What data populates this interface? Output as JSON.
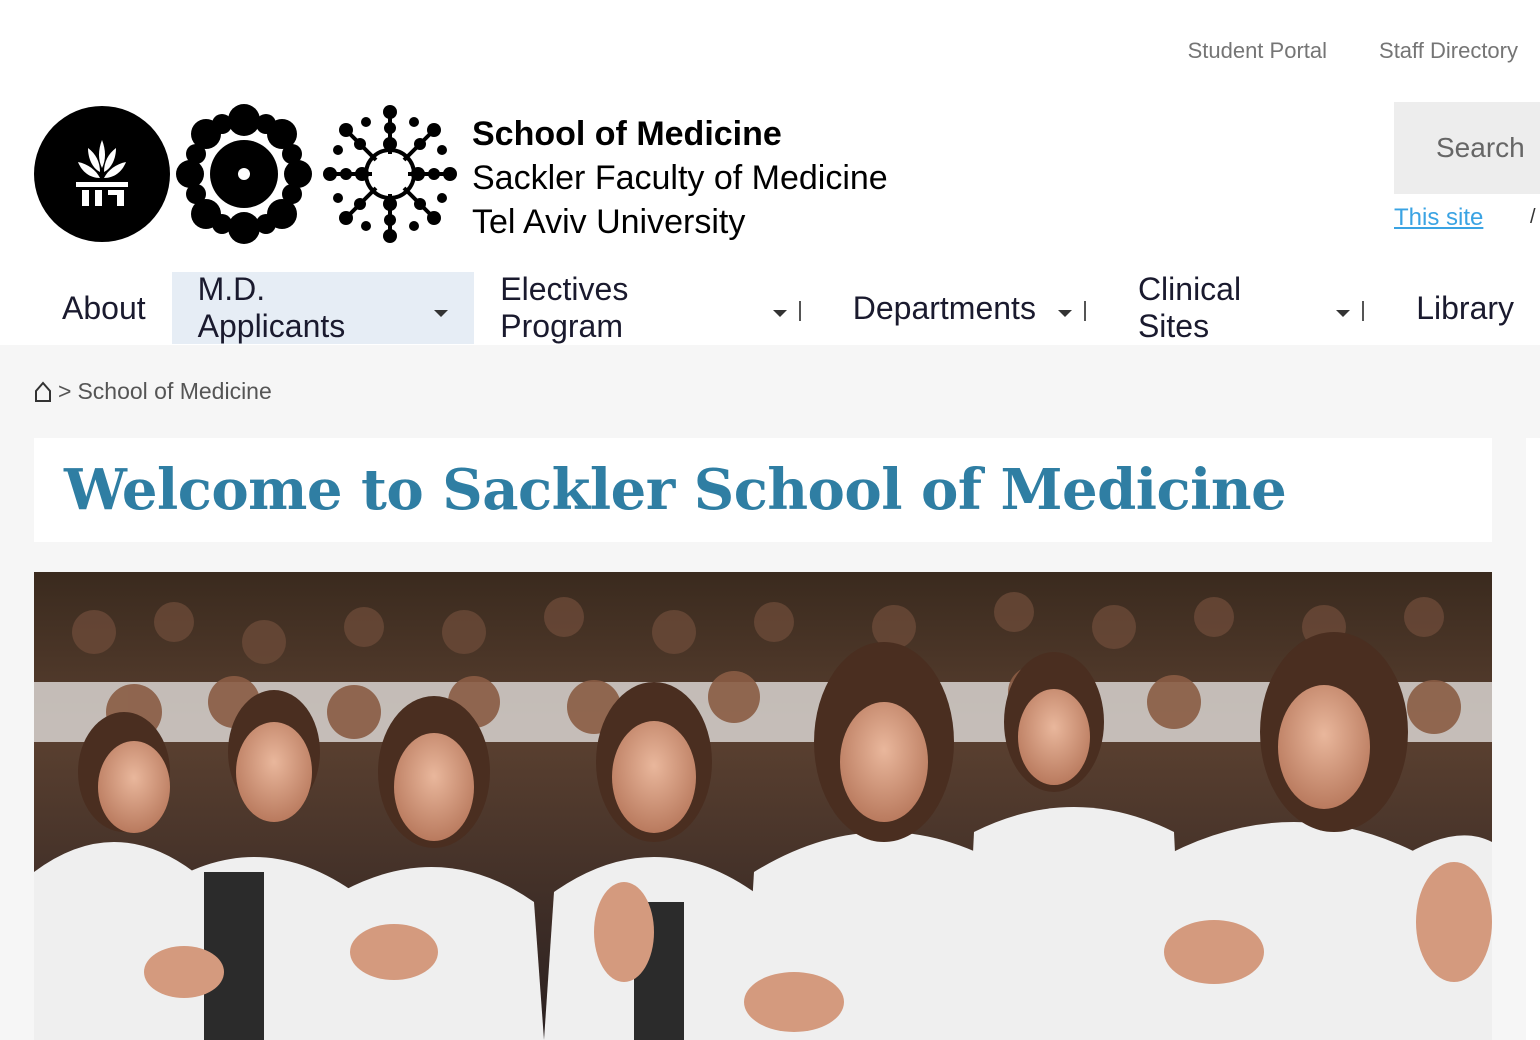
{
  "utility_nav": {
    "student_portal": "Student Portal",
    "staff_directory": "Staff Directory"
  },
  "branding": {
    "line1": "School of Medicine",
    "line2": "Sackler Faculty of Medicine",
    "line3": "Tel Aviv University",
    "logos": [
      "tel-aviv-university-seal",
      "flower-emblem",
      "molecule-emblem"
    ]
  },
  "search": {
    "placeholder": "Search",
    "scope_this_site": "This site",
    "scope_separator": "/"
  },
  "main_nav": {
    "items": [
      {
        "label": "About",
        "has_dropdown": false,
        "active": false
      },
      {
        "label": "M.D. Applicants",
        "has_dropdown": true,
        "active": true
      },
      {
        "label": "Electives Program",
        "has_dropdown": true,
        "active": false
      },
      {
        "label": "Departments",
        "has_dropdown": true,
        "active": false
      },
      {
        "label": "Clinical Sites",
        "has_dropdown": true,
        "active": false
      },
      {
        "label": "Library",
        "has_dropdown": false,
        "active": false
      }
    ]
  },
  "breadcrumb": {
    "home_icon": "home-icon",
    "separator": ">",
    "current": "School of Medicine"
  },
  "page": {
    "title": "Welcome to Sackler School of Medicine"
  },
  "hero": {
    "alt": "Medical students in white coats applauding"
  },
  "colors": {
    "title": "#2f7ea3",
    "link": "#3aa3e3",
    "active_nav_bg": "#e6edf5",
    "content_bg": "#f6f6f6"
  }
}
